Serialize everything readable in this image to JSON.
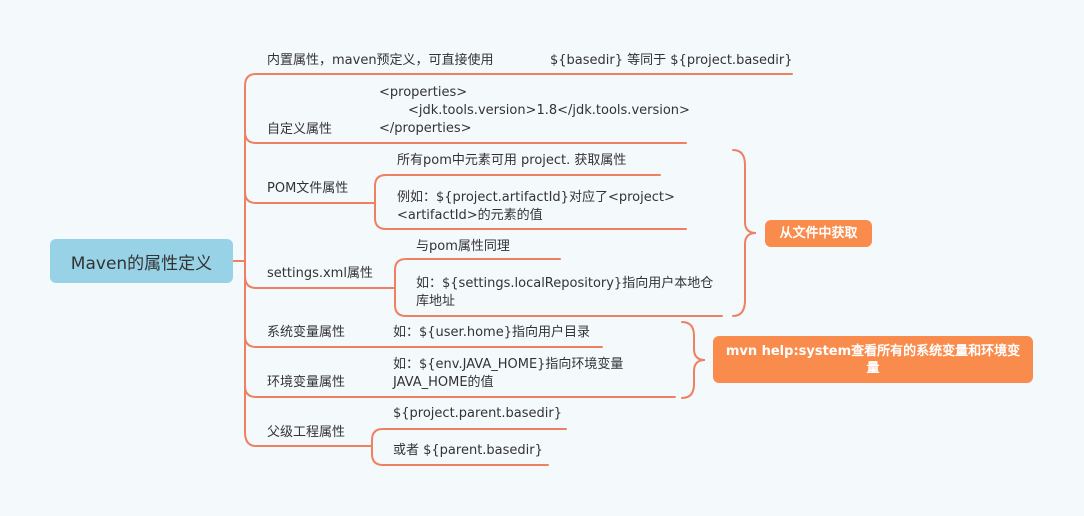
{
  "colors": {
    "line": "#f08062",
    "root_bg": "#98d2e7",
    "tag_bg": "#f98c4d",
    "background": "#f4f9fc"
  },
  "root": "Maven的属性定义",
  "branches": {
    "builtin": {
      "label": "内置属性，maven预定义，可直接使用",
      "detail": "${basedir} 等同于 ${project.basedir}"
    },
    "custom": {
      "label": "自定义属性",
      "lines": [
        "<properties>",
        "<jdk.tools.version>1.8</jdk.tools.version>",
        "</properties>"
      ]
    },
    "pom": {
      "label": "POM文件属性",
      "items": [
        "所有pom中元素可用 project. 获取属性",
        "例如：${project.artifactId}对应了<project><artifactId>的元素的值"
      ]
    },
    "settings": {
      "label": "settings.xml属性",
      "items": [
        "与pom属性同理",
        "如：${settings.localRepository}指向用户本地仓库地址"
      ]
    },
    "system": {
      "label": "系统变量属性",
      "detail": "如：${user.home}指向用户目录"
    },
    "env": {
      "label": "环境变量属性",
      "detail": "如：${env.JAVA_HOME}指向环境变量JAVA_HOME的值"
    },
    "parent": {
      "label": "父级工程属性",
      "items": [
        "${project.parent.basedir}",
        "或者 ${parent.basedir}"
      ]
    }
  },
  "summaries": {
    "from_file": "从文件中获取",
    "mvn_help": "mvn help:system查看所有的系统变量和环境变量"
  }
}
